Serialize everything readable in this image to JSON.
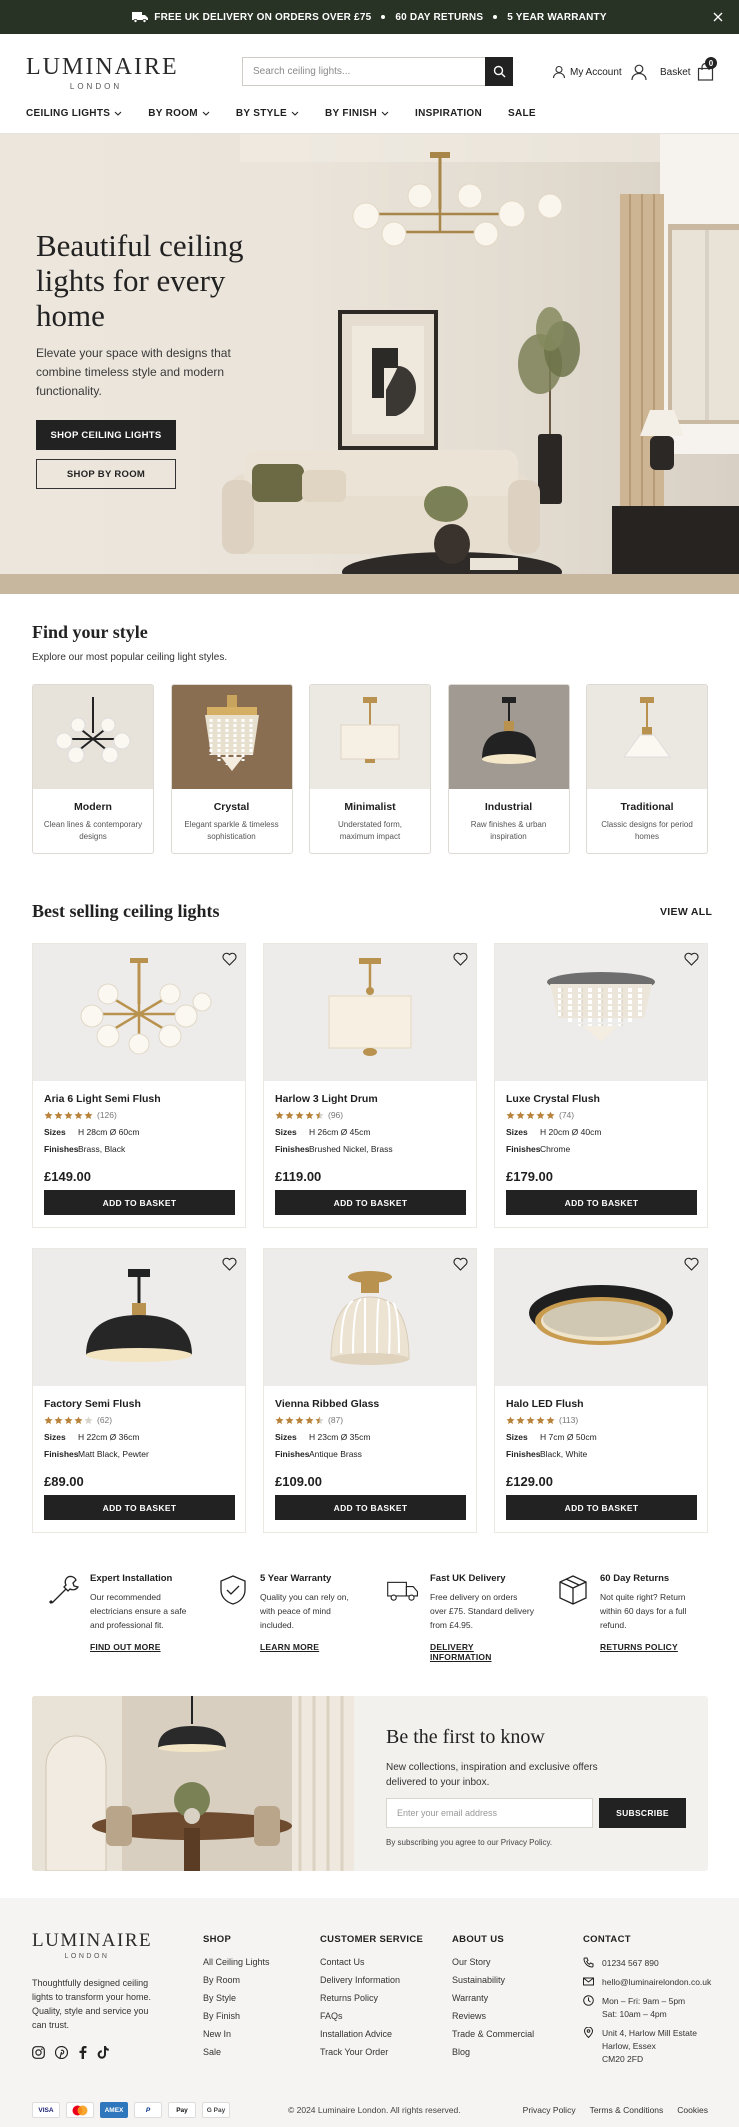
{
  "announcement": {
    "items": [
      "FREE UK DELIVERY ON ORDERS OVER £75",
      "60 DAY RETURNS",
      "5 YEAR WARRANTY"
    ]
  },
  "header": {
    "logo_main": "LUMINAIRE",
    "logo_sub": "LONDON",
    "search_placeholder": "Search ceiling lights...",
    "account_label": "My Account",
    "basket_label": "Basket",
    "basket_count": "0"
  },
  "nav": [
    "CEILING LIGHTS",
    "BY ROOM",
    "BY STYLE",
    "BY FINISH",
    "INSPIRATION",
    "SALE"
  ],
  "hero": {
    "title": "Beautiful ceiling lights for every home",
    "subtitle": "Elevate your space with designs that combine timeless style and modern functionality.",
    "primary_cta": "SHOP CEILING LIGHTS",
    "secondary_cta": "SHOP BY ROOM"
  },
  "find_style": {
    "title": "Find your style",
    "subtitle": "Explore our most popular ceiling light styles.",
    "cards": [
      {
        "name": "Modern",
        "desc": "Clean lines & contemporary designs"
      },
      {
        "name": "Crystal",
        "desc": "Elegant sparkle & timeless sophistication"
      },
      {
        "name": "Minimalist",
        "desc": "Understated form, maximum impact"
      },
      {
        "name": "Industrial",
        "desc": "Raw finishes & urban inspiration"
      },
      {
        "name": "Traditional",
        "desc": "Classic designs for period homes"
      }
    ]
  },
  "best_selling": {
    "title": "Best selling ceiling lights",
    "view_all": "VIEW ALL",
    "sizes_label": "Sizes",
    "finishes_label": "Finishes",
    "add_label": "ADD TO BASKET",
    "products": [
      {
        "name": "Aria 6 Light Semi Flush",
        "rating": 5,
        "reviews": "(126)",
        "sizes": "H 28cm  Ø 60cm",
        "finishes": "Brass, Black",
        "price": "£149.00"
      },
      {
        "name": "Harlow 3 Light Drum",
        "rating": 4.5,
        "reviews": "(96)",
        "sizes": "H 26cm  Ø 45cm",
        "finishes": "Brushed Nickel, Brass",
        "price": "£119.00"
      },
      {
        "name": "Luxe Crystal Flush",
        "rating": 5,
        "reviews": "(74)",
        "sizes": "H 20cm  Ø 40cm",
        "finishes": "Chrome",
        "price": "£179.00"
      },
      {
        "name": "Factory Semi Flush",
        "rating": 4,
        "reviews": "(62)",
        "sizes": "H 22cm  Ø 36cm",
        "finishes": "Matt Black, Pewter",
        "price": "£89.00"
      },
      {
        "name": "Vienna Ribbed Glass",
        "rating": 4.5,
        "reviews": "(87)",
        "sizes": "H 23cm  Ø 35cm",
        "finishes": "Antique Brass",
        "price": "£109.00"
      },
      {
        "name": "Halo LED Flush",
        "rating": 5,
        "reviews": "(113)",
        "sizes": "H 7cm  Ø 50cm",
        "finishes": "Black, White",
        "price": "£129.00"
      }
    ]
  },
  "usps": [
    {
      "title": "Expert Installation",
      "desc": "Our recommended electricians ensure a safe and professional fit.",
      "link": "FIND OUT MORE",
      "icon": "tools-icon"
    },
    {
      "title": "5 Year Warranty",
      "desc": "Quality you can rely on, with peace of mind included.",
      "link": "LEARN MORE",
      "icon": "shield-check-icon"
    },
    {
      "title": "Fast UK Delivery",
      "desc": "Free delivery on orders over £75. Standard delivery from £4.95.",
      "link": "DELIVERY INFORMATION",
      "icon": "truck-icon"
    },
    {
      "title": "60 Day Returns",
      "desc": "Not quite right? Return within 60 days for a full refund.",
      "link": "RETURNS POLICY",
      "icon": "box-icon"
    }
  ],
  "newsletter": {
    "title": "Be the first to know",
    "desc": "New collections, inspiration and exclusive offers delivered to your inbox.",
    "placeholder": "Enter your email address",
    "button": "SUBSCRIBE",
    "fine": "By subscribing you agree to our Privacy Policy."
  },
  "footer": {
    "logo_main": "LUMINAIRE",
    "logo_sub": "LONDON",
    "tagline": "Thoughtfully designed ceiling lights to transform your home. Quality, style and service you can trust.",
    "shop": {
      "heading": "SHOP",
      "links": [
        "All Ceiling Lights",
        "By Room",
        "By Style",
        "By Finish",
        "New In",
        "Sale"
      ]
    },
    "service": {
      "heading": "CUSTOMER SERVICE",
      "links": [
        "Contact Us",
        "Delivery Information",
        "Returns Policy",
        "FAQs",
        "Installation Advice",
        "Track Your Order"
      ]
    },
    "about": {
      "heading": "ABOUT US",
      "links": [
        "Our Story",
        "Sustainability",
        "Warranty",
        "Reviews",
        "Trade & Commercial",
        "Blog"
      ]
    },
    "contact": {
      "heading": "CONTACT",
      "phone": "01234 567 890",
      "email": "hello@luminairelondon.co.uk",
      "hours1": "Mon – Fri: 9am – 5pm",
      "hours2": "Sat: 10am – 4pm",
      "addr1": "Unit 4, Harlow Mill Estate",
      "addr2": "Harlow, Essex",
      "addr3": "CM20 2FD"
    },
    "payments": [
      "VISA",
      "MC",
      "AMEX",
      "P",
      "Pay",
      "G Pay"
    ],
    "copyright": "© 2024 Luminaire London. All rights reserved.",
    "legal": [
      "Privacy Policy",
      "Terms & Conditions",
      "Cookies"
    ]
  },
  "colors": {
    "announcement_bg": "#283225",
    "primary_button": "#222222",
    "star": "#b8823a",
    "brass": "#b8924e"
  }
}
